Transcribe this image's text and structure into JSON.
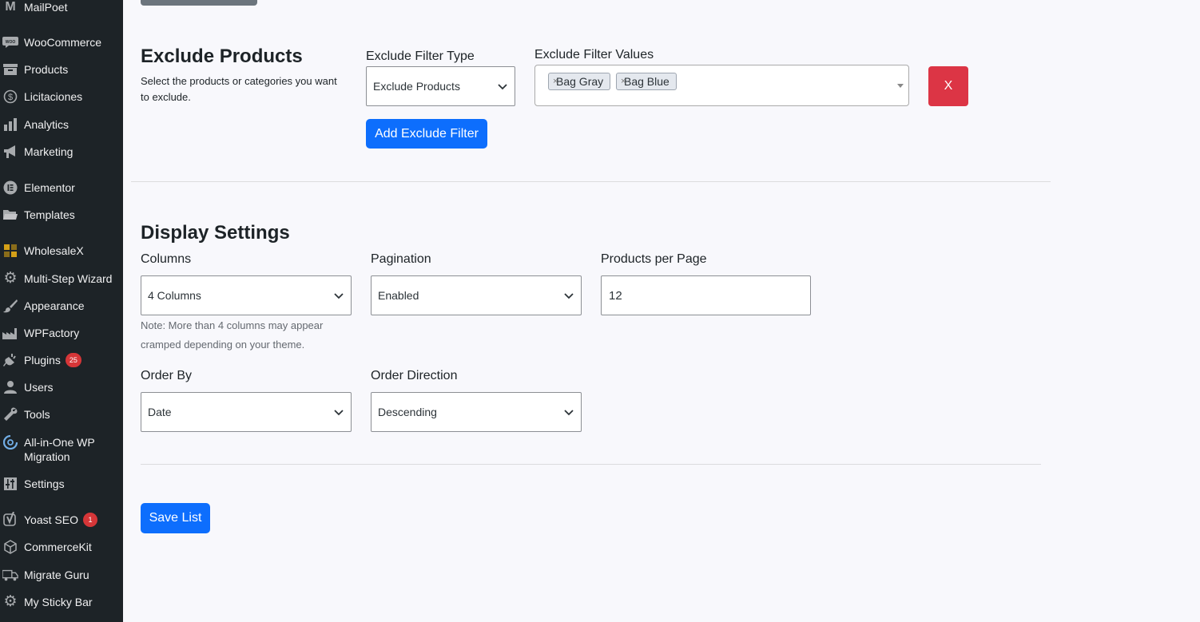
{
  "sidebar": {
    "items": [
      {
        "label": "MailPoet",
        "icon": "mailpoet-icon"
      },
      {
        "label": "WooCommerce",
        "icon": "woocommerce-icon"
      },
      {
        "label": "Products",
        "icon": "archive-box-icon"
      },
      {
        "label": "Licitaciones",
        "icon": "dollar-circle-icon"
      },
      {
        "label": "Analytics",
        "icon": "bar-chart-icon"
      },
      {
        "label": "Marketing",
        "icon": "megaphone-icon"
      },
      {
        "label": "Elementor",
        "icon": "elementor-icon"
      },
      {
        "label": "Templates",
        "icon": "folder-icon"
      },
      {
        "label": "WholesaleX",
        "icon": "wholesalex-icon"
      },
      {
        "label": "Multi-Step Wizard",
        "icon": "gear-icon"
      },
      {
        "label": "Appearance",
        "icon": "paintbrush-icon"
      },
      {
        "label": "WPFactory",
        "icon": "factory-icon"
      },
      {
        "label": "Plugins",
        "icon": "plug-icon",
        "badge": "25"
      },
      {
        "label": "Users",
        "icon": "user-icon"
      },
      {
        "label": "Tools",
        "icon": "wrench-icon"
      },
      {
        "label": "All-in-One WP Migration",
        "icon": "migration-icon"
      },
      {
        "label": "Settings",
        "icon": "sliders-icon"
      },
      {
        "label": "Yoast SEO",
        "icon": "yoast-icon",
        "badge": "1"
      },
      {
        "label": "CommerceKit",
        "icon": "cube-icon"
      },
      {
        "label": "Migrate Guru",
        "icon": "truck-icon"
      },
      {
        "label": "My Sticky Bar",
        "icon": "gear-icon"
      }
    ]
  },
  "exclude": {
    "title": "Exclude Products",
    "description": "Select the products or categories you want to exclude.",
    "filter_type_label": "Exclude Filter Type",
    "filter_type_value": "Exclude Products",
    "filter_values_label": "Exclude Filter Values",
    "tags": [
      "Bag Gray",
      "Bag Blue"
    ],
    "tag_remove": "×",
    "remove_button": "X",
    "add_button": "Add Exclude Filter"
  },
  "display": {
    "title": "Display Settings",
    "columns_label": "Columns",
    "columns_value": "4 Columns",
    "columns_note": "Note: More than 4 columns may appear cramped depending on your theme.",
    "pagination_label": "Pagination",
    "pagination_value": "Enabled",
    "per_page_label": "Products per Page",
    "per_page_value": "12",
    "order_by_label": "Order By",
    "order_by_value": "Date",
    "order_dir_label": "Order Direction",
    "order_dir_value": "Descending"
  },
  "save_button": "Save List",
  "colors": {
    "sidebar_bg": "#1d2327",
    "primary": "#0d6efd",
    "danger": "#dc3545",
    "badge": "#d63638"
  }
}
